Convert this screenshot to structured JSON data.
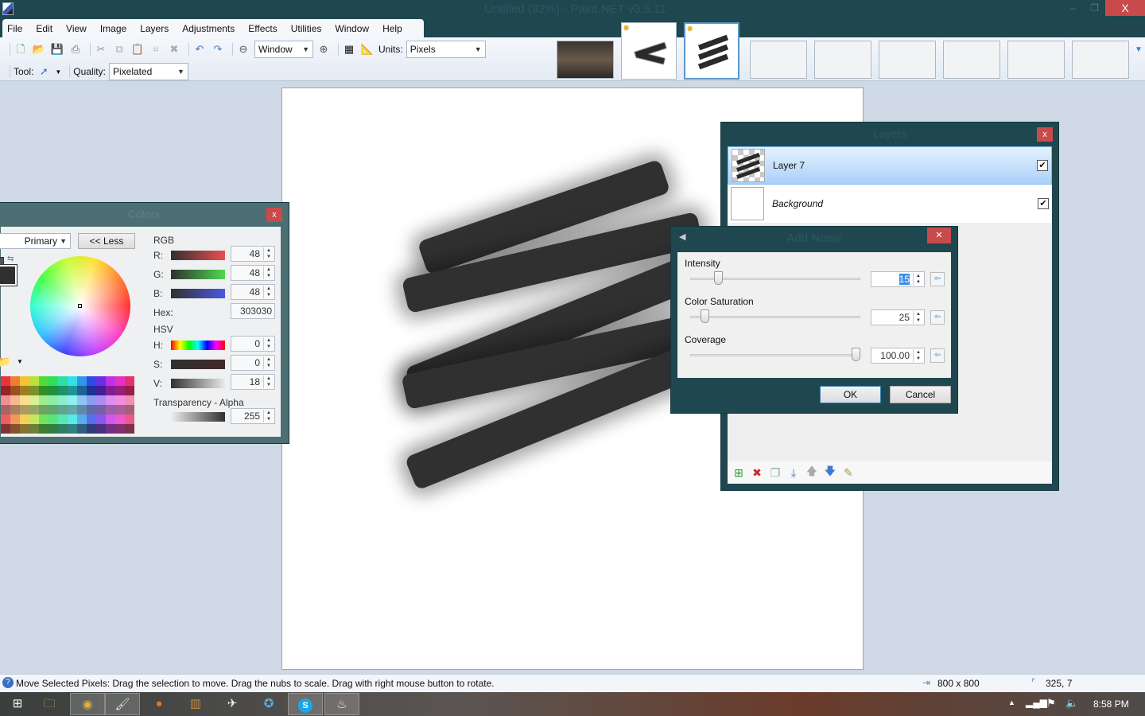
{
  "window": {
    "title": "Untitled (92%) - Paint.NET v3.5.11",
    "minimize": "–",
    "restore": "❐",
    "close": "X"
  },
  "menu": [
    "File",
    "Edit",
    "View",
    "Image",
    "Layers",
    "Adjustments",
    "Effects",
    "Utilities",
    "Window",
    "Help"
  ],
  "toolbar": {
    "zoom_value": "Window",
    "units_label": "Units:",
    "units_value": "Pixels",
    "tool_label": "Tool:",
    "quality_label": "Quality:",
    "quality_value": "Pixelated"
  },
  "image_tabs": {
    "count": 10,
    "selected_index": 2,
    "unsaved_marker": "✸"
  },
  "colors_panel": {
    "title": "Colors",
    "close": "x",
    "mode_select": "Primary",
    "less_button": "<< Less",
    "rgb_label": "RGB",
    "r_label": "R:",
    "r": "48",
    "g_label": "G:",
    "g": "48",
    "b_label": "B:",
    "b": "48",
    "hex_label": "Hex:",
    "hex": "303030",
    "hsv_label": "HSV",
    "h_label": "H:",
    "h": "0",
    "s_label": "S:",
    "s": "0",
    "v_label": "V:",
    "v": "18",
    "alpha_label": "Transparency - Alpha",
    "alpha": "255",
    "primary_color": "#303030",
    "palette": [
      "#e8343a",
      "#ef7d32",
      "#f2c431",
      "#b8e23a",
      "#4ddc3b",
      "#2ee05a",
      "#2ee0a1",
      "#30e3e6",
      "#2f96e8",
      "#2f4ae6",
      "#6530e6",
      "#c230e6",
      "#e630c2",
      "#e6306e"
    ]
  },
  "layers_panel": {
    "title": "Layers",
    "close": "x",
    "layers": [
      {
        "name": "Layer 7",
        "visible": true,
        "selected": true
      },
      {
        "name": "Background",
        "visible": true,
        "selected": false
      }
    ],
    "check": "✔"
  },
  "add_noise": {
    "title": "Add Noise",
    "close": "✕",
    "intensity_label": "Intensity",
    "intensity": "15",
    "intensity_min": 0,
    "intensity_max": 100,
    "saturation_label": "Color Saturation",
    "saturation": "25",
    "saturation_min": 0,
    "saturation_max": 400,
    "coverage_label": "Coverage",
    "coverage": "100.00",
    "coverage_min": 0,
    "coverage_max": 100,
    "ok": "OK",
    "cancel": "Cancel"
  },
  "status": {
    "message": "Move Selected Pixels: Drag the selection to move. Drag the nubs to scale. Drag with right mouse button to rotate.",
    "image_size": "800 x 800",
    "cursor_position": "325, 7"
  },
  "taskbar": {
    "items": [
      "windows-start",
      "file-explorer",
      "chrome",
      "paint-net",
      "origin",
      "media-player",
      "plane-app",
      "network-app",
      "skype",
      "steam"
    ],
    "clock": "8:58 PM"
  }
}
